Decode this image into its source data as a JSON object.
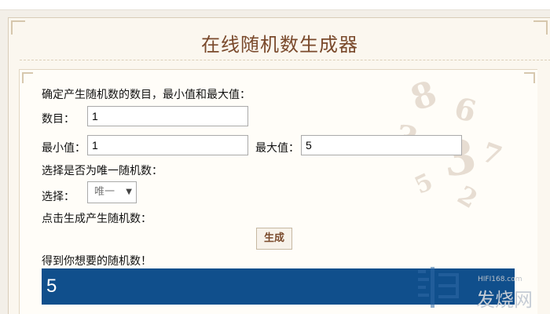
{
  "page": {
    "title": "在线随机数生成器"
  },
  "form": {
    "instruction": "确定产生随机数的数目，最小值和最大值：",
    "count_label": "数目：",
    "count_value": "1",
    "min_label": "最小值：",
    "min_value": "1",
    "max_label": "最大值：",
    "max_value": "5",
    "unique_question": "选择是否为唯一随机数：",
    "select_label": "选择：",
    "select_value": "唯一",
    "generate_hint": "点击生成产生随机数：",
    "generate_button": "生成",
    "result_label": "得到你想要的随机数！",
    "result_value": "5"
  },
  "watermark": {
    "site": "HIFI168.com",
    "name": "发烧网"
  },
  "colors": {
    "accent": "#7a4a2c",
    "result_bg": "#104f8c",
    "page_bg": "#f3efe8"
  }
}
